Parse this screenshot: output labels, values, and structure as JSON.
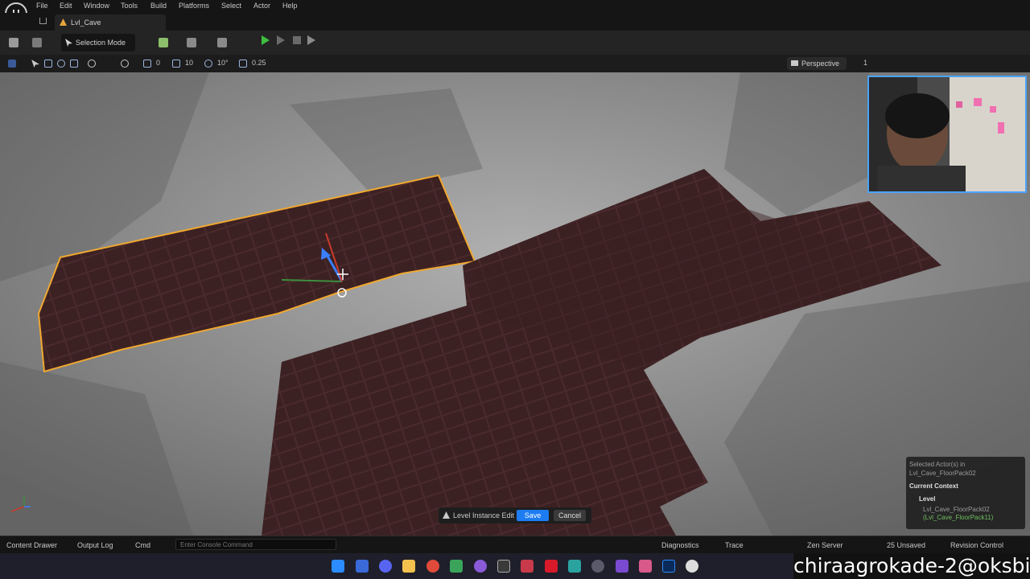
{
  "menubar": {
    "logo": "U",
    "items": [
      "File",
      "Edit",
      "Window",
      "Tools",
      "Build",
      "Platforms",
      "Select",
      "Actor",
      "Help"
    ]
  },
  "tab": {
    "label": "Lvl_Cave"
  },
  "toolbar": {
    "selection_mode": "Selection Mode"
  },
  "viewport_toolbar": {
    "rotate_snap_count": "0",
    "grid_snap": "10",
    "angle_snap": "10°",
    "scale_snap": "0.25",
    "perspective": "Perspective",
    "extra": "1"
  },
  "level_instance": {
    "label": "Level Instance Edit",
    "save": "Save",
    "cancel": "Cancel"
  },
  "context": {
    "selected_line1": "Selected Actor(s) in",
    "selected_line2": "Lvl_Cave_FloorPack02",
    "current_context": "Current Context",
    "level": "Level",
    "floorpack": "Lvl_Cave_FloorPack02",
    "floorpack_child": "(Lvl_Cave_FloorPack11)"
  },
  "statusbar": {
    "content_drawer": "Content Drawer",
    "output_log": "Output Log",
    "cmd": "Cmd",
    "console_placeholder": "Enter Console Command",
    "diagnostics": "Diagnostics",
    "trace": "Trace",
    "zen_server": "Zen Server",
    "unsaved": "25 Unsaved",
    "revision_control": "Revision Control"
  },
  "watermark": "chiraagrokade-2@oksbi",
  "colors": {
    "selection_outline": "#f0a830",
    "save_button": "#1d7cf2",
    "play_green": "#3fbf3f",
    "rock": "#4a2a2c"
  }
}
